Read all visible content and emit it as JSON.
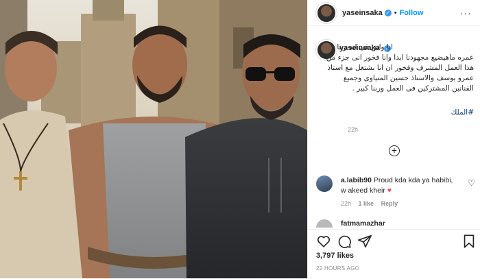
{
  "header": {
    "username": "yaseinsaka",
    "verified_mark": "✓",
    "separator": "•",
    "follow_label": "Follow",
    "more_label": "···"
  },
  "caption": {
    "username": "yaseinsaka",
    "text": "انا واثق فى انه ربنا عمره ماهيضيع مجهودنا ابدا وانا فخور انى جزء من هذا العمل المشرف وفخور ان انا بشتغل مع استاذ عمرو يوسف والاستاذ حسين المنياوى وجميع الفنانين المشتركين فى العمل وربنا كبير .",
    "hashtag": "#الملك",
    "time": "22h"
  },
  "load_more_label": "+",
  "comments": [
    {
      "username": "a.labib90",
      "text": "Proud kda kda ya habibi, w akeed kheir",
      "emoji": "♥",
      "time": "22h",
      "likes": "1 like",
      "reply_label": "Reply",
      "like_icon": "heart-outline-icon"
    },
    {
      "username": "fatmamazhar"
    }
  ],
  "actions": {
    "icons": [
      "heart-icon",
      "comment-icon",
      "share-icon",
      "bookmark-icon"
    ],
    "likes": "3,797 likes",
    "posted": "22 HOURS AGO"
  },
  "colors": {
    "link": "#0095f6",
    "text": "#262626",
    "muted": "#8e8e8e",
    "verified": "#3897f0",
    "heart": "#ed4956"
  }
}
